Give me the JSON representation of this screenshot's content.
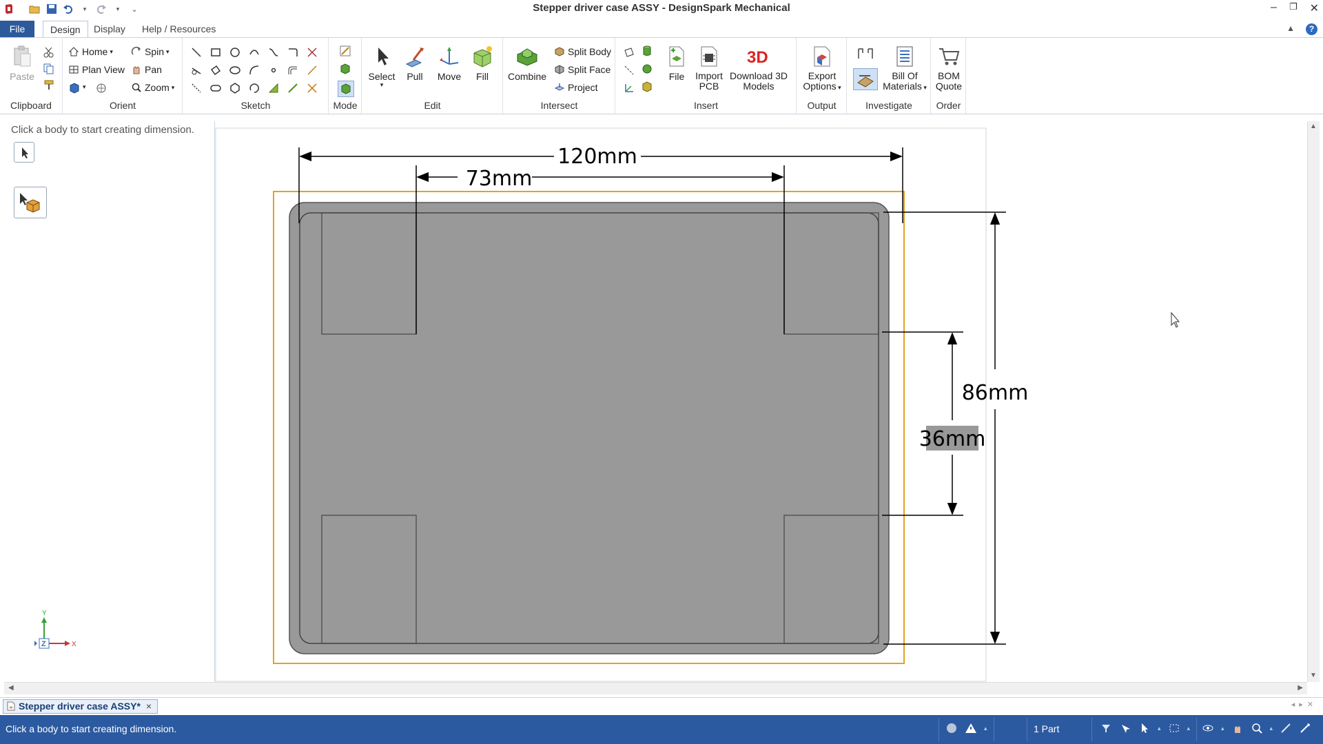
{
  "window": {
    "title": "Stepper driver case ASSY* - DesignSpark Mechanical",
    "title_display": "Stepper driver case ASSY - DesignSpark Mechanical"
  },
  "tabs": {
    "file": "File",
    "design": "Design",
    "display": "Display",
    "help": "Help / Resources"
  },
  "ribbon": {
    "clipboard": {
      "paste": "Paste",
      "label": "Clipboard"
    },
    "orient": {
      "home": "Home",
      "spin": "Spin",
      "plan_view": "Plan View",
      "pan": "Pan",
      "zoom": "Zoom",
      "label": "Orient"
    },
    "sketch": {
      "label": "Sketch"
    },
    "mode": {
      "label": "Mode"
    },
    "edit": {
      "select": "Select",
      "pull": "Pull",
      "move": "Move",
      "fill": "Fill",
      "label": "Edit"
    },
    "intersect": {
      "combine": "Combine",
      "split_body": "Split Body",
      "split_face": "Split Face",
      "project": "Project",
      "label": "Intersect"
    },
    "insert": {
      "file": "File",
      "import_pcb_1": "Import",
      "import_pcb_2": "PCB",
      "download_1": "Download 3D",
      "download_2": "Models",
      "label": "Insert"
    },
    "output": {
      "export_1": "Export",
      "export_2": "Options",
      "label": "Output"
    },
    "investigate": {
      "bom_1": "Bill Of",
      "bom_2": "Materials",
      "label": "Investigate"
    },
    "order": {
      "quote_1": "BOM",
      "quote_2": "Quote",
      "label": "Order"
    }
  },
  "panel": {
    "hint": "Click a body to start creating dimension."
  },
  "drawing": {
    "dim_width_total": "120mm",
    "dim_width_inner": "73mm",
    "dim_height_total": "86mm",
    "dim_height_inner": "36mm",
    "axis_y": "Y",
    "axis_z": "Z",
    "axis_x": "X"
  },
  "document_tab": {
    "label": "Stepper driver case ASSY*",
    "close": "×"
  },
  "status": {
    "message": "Click a body to start creating dimension.",
    "parts": "1 Part"
  },
  "colors": {
    "accent": "#2c5aa0",
    "body_fill": "#999999",
    "selection_outline": "#e8a020"
  }
}
